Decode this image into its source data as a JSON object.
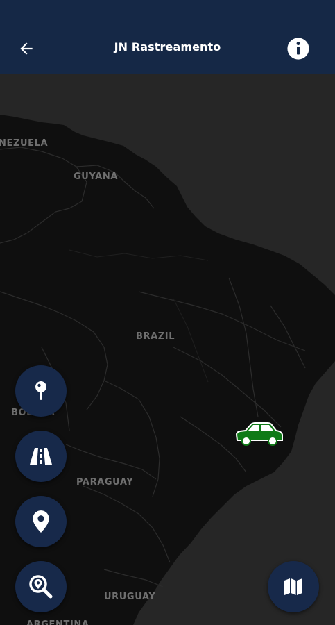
{
  "header": {
    "title": "JN Rastreamento",
    "back_icon": "arrow-left-icon",
    "info_icon": "info-icon",
    "background_color": "#152846"
  },
  "map": {
    "theme": "dark",
    "labels": {
      "venezuela": "NEZUELA",
      "guyana": "GUYANA",
      "brazil": "BRAZIL",
      "bolivia": "BOLIVIA",
      "paraguay": "PARAGUAY",
      "uruguay": "URUGUAY",
      "argentina": "ARGENTINA"
    },
    "vehicle": {
      "icon": "car-icon",
      "color": "#0f7a17"
    }
  },
  "controls": {
    "left": [
      {
        "name": "pin-tool-button",
        "icon": "pushpin-icon"
      },
      {
        "name": "route-button",
        "icon": "road-icon"
      },
      {
        "name": "location-button",
        "icon": "map-marker-icon"
      },
      {
        "name": "zoom-search-button",
        "icon": "zoom-search-icon"
      }
    ],
    "right": {
      "name": "map-type-button",
      "icon": "map-icon"
    },
    "button_color": "#17294a"
  }
}
